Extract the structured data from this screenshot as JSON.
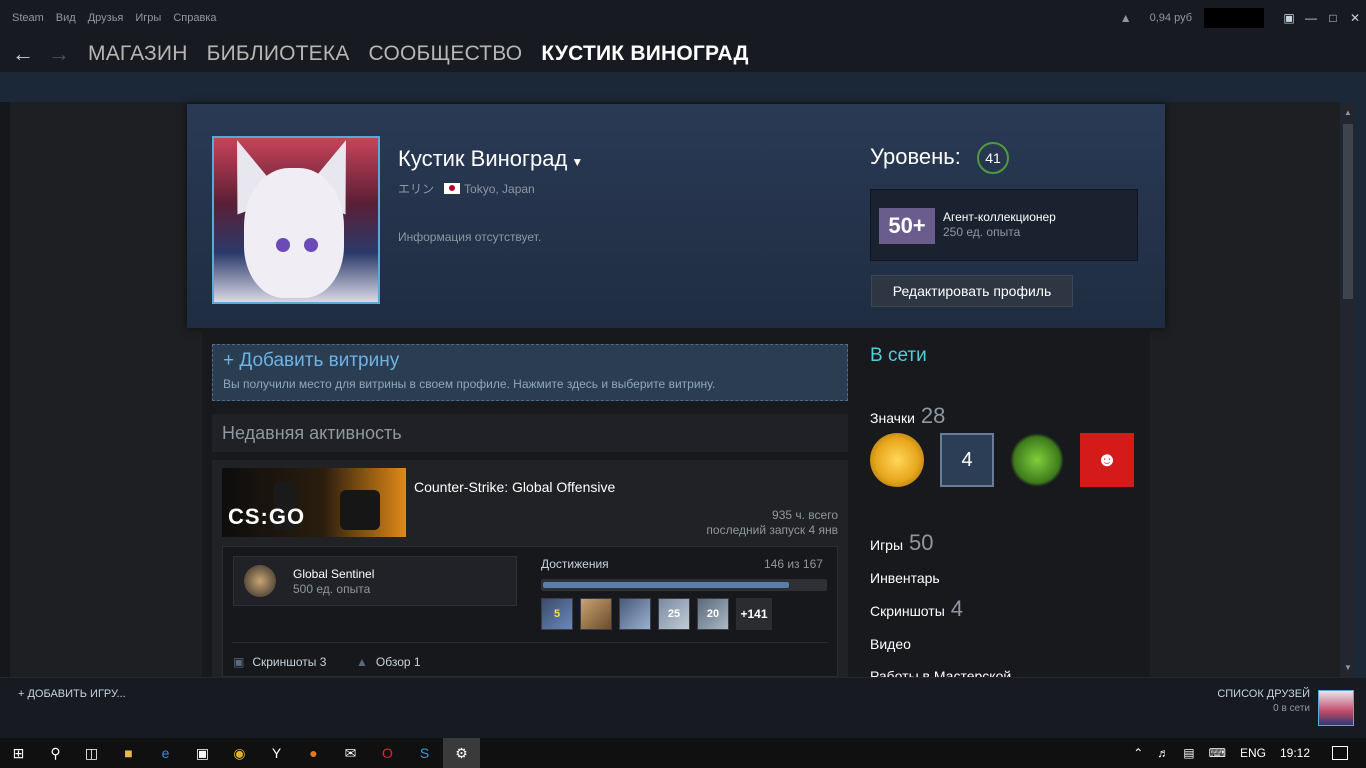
{
  "menubar": {
    "items": [
      "Steam",
      "Вид",
      "Друзья",
      "Игры",
      "Справка"
    ],
    "wallet": "0,94 руб"
  },
  "nav": {
    "links": [
      "МАГАЗИН",
      "БИБЛИОТЕКА",
      "СООБЩЕСТВО",
      "КУСТИК ВИНОГРАД"
    ]
  },
  "profile": {
    "persona_name": "Кустик Виноград",
    "real_name": "エリン",
    "location": "Tokyo, Japan",
    "summary": "Информация отсутствует.",
    "level_label": "Уровень:",
    "level": "41",
    "featured_badge": {
      "icon_text": "50+",
      "name": "Агент-коллекционер",
      "xp": "250 ед. опыта"
    },
    "edit_button": "Редактировать профиль"
  },
  "showcase": {
    "title": "+ Добавить витрину",
    "description": "Вы получили место для витрины в своем профиле. Нажмите здесь и выберите витрину."
  },
  "recent_activity": {
    "header": "Недавняя активность",
    "game": {
      "name": "Counter-Strike: Global Offensive",
      "logo_text": "CS:GO",
      "hours": "935 ч. всего",
      "last_played": "последний запуск 4 янв",
      "badge_name": "Global Sentinel",
      "badge_xp": "500 ед. опыта",
      "achievements_label": "Достижения",
      "achievements_count": "146 из 167",
      "achievements_progress": 0.874,
      "achievement_icons": [
        "5",
        "",
        "",
        "25",
        "20"
      ],
      "more_achievements": "+141",
      "screenshots": "Скриншоты 3",
      "reviews": "Обзор 1"
    }
  },
  "sidebar": {
    "status": "В сети",
    "badges_label": "Значки",
    "badges_count": "28",
    "badge_level_text": "4",
    "games_label": "Игры",
    "games_count": "50",
    "inventory_label": "Инвентарь",
    "screenshots_label": "Скриншоты",
    "screenshots_count": "4",
    "videos_label": "Видео",
    "workshop_label": "Работы в Мастерской"
  },
  "bottombar": {
    "add_game": "+ ДОБАВИТЬ ИГРУ...",
    "friends_list": "СПИСОК ДРУЗЕЙ",
    "friends_online": "0 в сети"
  },
  "taskbar": {
    "language": "ENG",
    "time": "19:12"
  },
  "colors": {
    "accent_blue": "#57cbde",
    "level_ring": "#4f9a3d",
    "background": "#1b2838"
  }
}
